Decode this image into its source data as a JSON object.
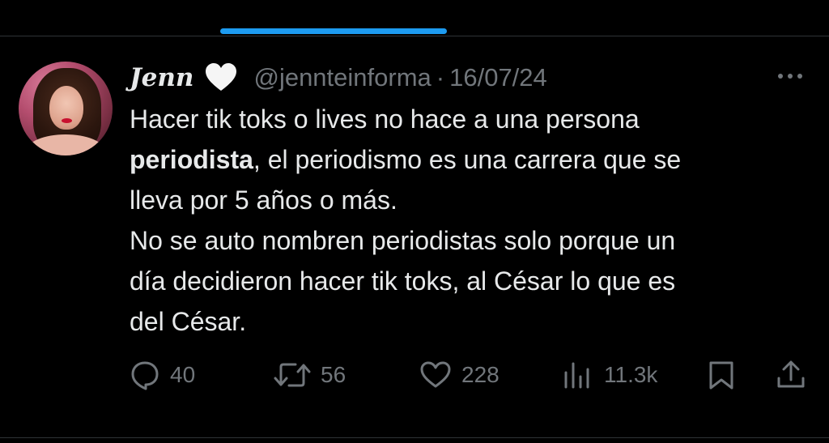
{
  "tweet": {
    "author": {
      "display_name": "Jenn",
      "name_emoji": "white-heart",
      "handle": "@jennteinforma"
    },
    "separator": "·",
    "date": "16/07/24",
    "body": {
      "line1": "Hacer tik toks o lives no hace a una persona",
      "line2_bold": "periodista",
      "line2_rest": ", el periodismo es una carrera que se",
      "line3": "lleva por 5 años o más.",
      "line4": "No se auto nombren periodistas solo porque un",
      "line5": "día decidieron hacer tik toks, al César lo que es",
      "line6": "del César."
    },
    "metrics": {
      "replies": "40",
      "retweets": "56",
      "likes": "228",
      "views": "11.3k"
    }
  },
  "icons": {
    "reply": "reply-icon",
    "retweet": "retweet-icon",
    "like": "heart-icon",
    "views": "views-icon",
    "bookmark": "bookmark-icon",
    "share": "share-icon",
    "more": "more-icon"
  },
  "colors": {
    "background": "#000000",
    "text": "#e7e9ea",
    "secondary": "#71767b",
    "accent": "#1d9bf0",
    "divider": "#2f3336"
  }
}
